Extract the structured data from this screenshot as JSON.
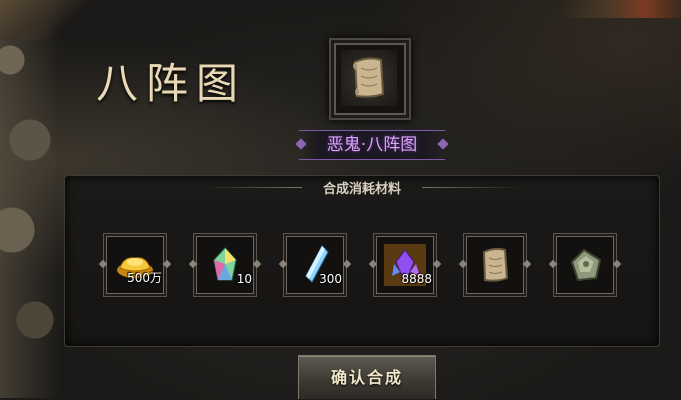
{
  "title": "八阵图",
  "item_name": "恶鬼·八阵图",
  "item_icon": "scroll-icon",
  "materials_title": "合成消耗材料",
  "materials": [
    {
      "name": "gold-ingot-icon",
      "qty": "500万"
    },
    {
      "name": "rainbow-crystal-icon",
      "qty": "10"
    },
    {
      "name": "blue-crystal-icon",
      "qty": "300"
    },
    {
      "name": "purple-gem-icon",
      "qty": "8888"
    },
    {
      "name": "scroll-icon",
      "qty": ""
    },
    {
      "name": "jade-fragment-icon",
      "qty": ""
    }
  ],
  "confirm_label": "确认合成",
  "colors": {
    "accent_purple": "#d7a8f0",
    "title_gold": "#e8d9b4"
  }
}
